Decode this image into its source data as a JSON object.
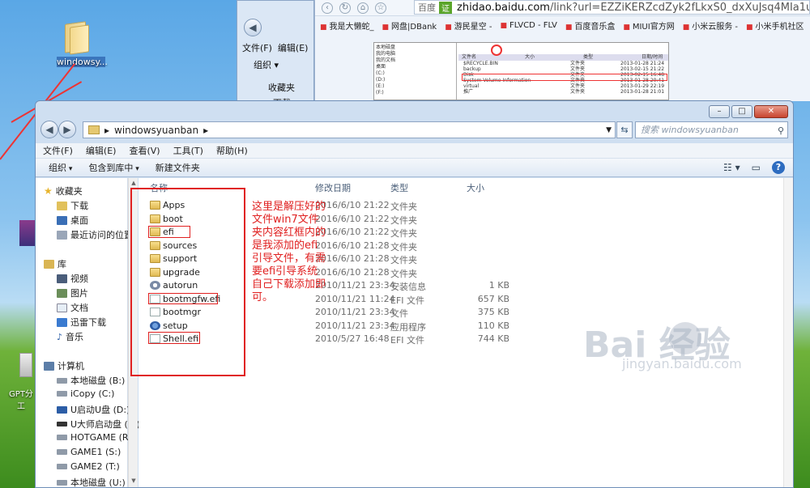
{
  "desktop": {
    "folder_label": "windowsy...",
    "gpt_label": "GPT分\n工"
  },
  "browser": {
    "badge": "百度",
    "badge2": "证",
    "url_domain": "zhidao.baidu.com",
    "url_rest": "/link?url=EZZiKERZcdZyk2fLkxS0_dxXuJsq4MIa1uiJKYoaIj_RE",
    "bookmarks": [
      "我是大懒蛇_",
      "网盘|DBank",
      "游民星空 -",
      "FLVCD - FLV",
      "百度音乐盒",
      "MIUI官方网",
      "小米云服务 -",
      "小米手机社区"
    ],
    "inner_image": {
      "tree_title": "本地磁盘",
      "tree_items": [
        "我的电脑",
        "我的文档",
        "桌面",
        "(C:)",
        "(D:)",
        "(E:)",
        "(F:)"
      ],
      "pane_header": [
        "文件名",
        "大小",
        "类型",
        "日期/时间"
      ],
      "pane_rows": [
        [
          "$RECYCLE.BIN",
          "",
          "文件夹",
          "2013-01-28 21:24"
        ],
        [
          "backup",
          "",
          "文件夹",
          "2013-02-15 21:22"
        ],
        [
          "Disk",
          "",
          "文件夹",
          "2013-02-15 16:48"
        ],
        [
          "System Volume Information",
          "",
          "文件夹",
          "2013-01-28 20:41"
        ],
        [
          "virtual",
          "",
          "文件夹",
          "2013-01-29 22:19"
        ],
        [
          "推广",
          "",
          "文件夹",
          "2013-01-28 21:01"
        ]
      ]
    }
  },
  "bg_explorer": {
    "menu_file": "文件(F)",
    "menu_edit": "编辑(E)",
    "organize": "组织 ▾",
    "favorites": "收藏夹",
    "downloads": "下载"
  },
  "explorer": {
    "window_controls": [
      "–",
      "□",
      "✕"
    ],
    "breadcrumb": "windowsyuanban",
    "search_placeholder": "搜索 windowsyuanban",
    "menu": [
      "文件(F)",
      "编辑(E)",
      "查看(V)",
      "工具(T)",
      "帮助(H)"
    ],
    "toolbar": [
      "组织",
      "包含到库中",
      "新建文件夹"
    ],
    "columns": {
      "name": "名称",
      "date": "修改日期",
      "type": "类型",
      "size": "大小"
    },
    "nav": {
      "favorites": "收藏夹",
      "downloads": "下载",
      "desktop": "桌面",
      "recent": "最近访问的位置",
      "libraries": "库",
      "videos": "视频",
      "pictures": "图片",
      "documents": "文档",
      "xunlei": "迅雷下载",
      "music": "音乐",
      "computer": "计算机",
      "drives": [
        "本地磁盘 (B:)",
        "iCopy (C:)",
        "U启动U盘 (D:)",
        "U大师启动盘 (E:)",
        "HOTGAME (R:)",
        "GAME1 (S:)",
        "GAME2 (T:)",
        "本地磁盘 (U:)"
      ]
    },
    "files": [
      {
        "name": "Apps",
        "date": "2016/6/10 21:22",
        "type": "文件夹",
        "size": "",
        "icon": "folder-icon"
      },
      {
        "name": "boot",
        "date": "2016/6/10 21:22",
        "type": "文件夹",
        "size": "",
        "icon": "folder-icon"
      },
      {
        "name": "efi",
        "date": "2016/6/10 21:22",
        "type": "文件夹",
        "size": "",
        "icon": "folder-icon"
      },
      {
        "name": "sources",
        "date": "2016/6/10 21:28",
        "type": "文件夹",
        "size": "",
        "icon": "folder-icon"
      },
      {
        "name": "support",
        "date": "2016/6/10 21:28",
        "type": "文件夹",
        "size": "",
        "icon": "folder-icon"
      },
      {
        "name": "upgrade",
        "date": "2016/6/10 21:28",
        "type": "文件夹",
        "size": "",
        "icon": "folder-icon"
      },
      {
        "name": "autorun",
        "date": "2010/11/21 23:34",
        "type": "安装信息",
        "size": "1 KB",
        "icon": "settings-file-icon"
      },
      {
        "name": "bootmgfw.efi",
        "date": "2010/11/21 11:24",
        "type": "EFI 文件",
        "size": "657 KB",
        "icon": "file-icon"
      },
      {
        "name": "bootmgr",
        "date": "2010/11/21 23:34",
        "type": "文件",
        "size": "375 KB",
        "icon": "file-icon"
      },
      {
        "name": "setup",
        "date": "2010/11/21 23:34",
        "type": "应用程序",
        "size": "110 KB",
        "icon": "setup-icon"
      },
      {
        "name": "Shell.efi",
        "date": "2010/5/27 16:48",
        "type": "EFI 文件",
        "size": "744 KB",
        "icon": "file-icon"
      }
    ]
  },
  "annotation": "这里是解压好的文件win7文件夹内容红框内的是我添加的efi引导文件，有需要efi引导系统自己下载添加即可。",
  "watermark": {
    "main": "Bai 经验",
    "sub": "jingyan.baidu.com"
  },
  "colors": {
    "annotation_red": "#e02020",
    "window_frame": "#cfdff1"
  }
}
